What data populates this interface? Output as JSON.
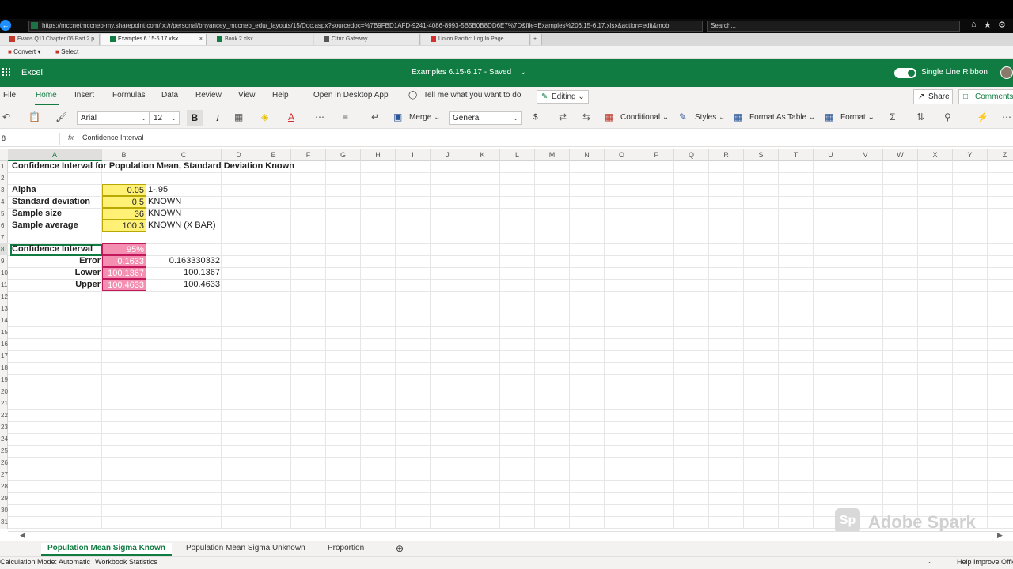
{
  "browser": {
    "url": "https://mccnetmccneb-my.sharepoint.com/:x:/r/personal/bhyancey_mccneb_edu/_layouts/15/Doc.aspx?sourcedoc=%7B9FBD1AFD-9241-4086-8993-5B5B0B8DD6E7%7D&file=Examples%206.15-6.17.xlsx&action=edit&mob",
    "search_placeholder": "Search...",
    "tabs": [
      {
        "label": "Evans Q11 Chapter 06 Part 2.p..."
      },
      {
        "label": "Examples 6.15-6.17.xlsx"
      },
      {
        "label": "Book 2.xlsx"
      },
      {
        "label": "Citrix Gateway"
      },
      {
        "label": "Union Pacific: Log In Page"
      }
    ],
    "favorites": {
      "convert": "Convert",
      "select": "Select"
    }
  },
  "app": {
    "name": "Excel",
    "doc_title": "Examples 6.15-6.17 - Saved",
    "single_line_ribbon": "Single Line Ribbon"
  },
  "ribbon": {
    "tabs": [
      "File",
      "Home",
      "Insert",
      "Formulas",
      "Data",
      "Review",
      "View",
      "Help",
      "Open in Desktop App"
    ],
    "tell_me": "Tell me what you want to do",
    "editing": "Editing",
    "share": "Share",
    "comments": "Comments"
  },
  "toolbar": {
    "font": "Arial",
    "size": "12",
    "bold": "B",
    "italic": "I",
    "merge": "Merge",
    "number_format": "General",
    "currency": "$",
    "conditional": "Conditional",
    "styles": "Styles",
    "format_as_table": "Format As Table",
    "format": "Format"
  },
  "formula_bar": {
    "name_box": "8",
    "fx": "fx",
    "content": "Confidence Interval"
  },
  "grid": {
    "columns": [
      "A",
      "B",
      "C",
      "D",
      "E",
      "F",
      "G",
      "H",
      "I",
      "J",
      "K",
      "L",
      "M",
      "N",
      "O",
      "P",
      "Q",
      "R",
      "S",
      "T",
      "U",
      "V",
      "W",
      "X",
      "Y",
      "Z"
    ],
    "rows": [
      "1",
      "2",
      "3",
      "4",
      "5",
      "6",
      "7",
      "8",
      "9",
      "10",
      "11",
      "12",
      "13",
      "14",
      "15",
      "16",
      "17",
      "18",
      "19",
      "20",
      "21",
      "22",
      "23",
      "24",
      "25",
      "26",
      "27",
      "28",
      "29",
      "30",
      "31"
    ],
    "title": "Confidence Interval for Population Mean, Standard Deviation Known",
    "inputs": [
      {
        "label": "Alpha",
        "value": "0.05",
        "note": "1-.95"
      },
      {
        "label": "Standard deviation",
        "value": "0.5",
        "note": "KNOWN"
      },
      {
        "label": "Sample size",
        "value": "36",
        "note": "KNOWN"
      },
      {
        "label": "Sample average",
        "value": "100.3",
        "note": "KNOWN (X BAR)"
      }
    ],
    "ci": {
      "label": "Confidence Interval",
      "level": "95%",
      "rows": [
        {
          "label": "Error",
          "value": "0.1633",
          "full": "0.163330332"
        },
        {
          "label": "Lower",
          "value": "100.1367",
          "full": "100.1367"
        },
        {
          "label": "Upper",
          "value": "100.4633",
          "full": "100.4633"
        }
      ]
    }
  },
  "sheets": [
    "Population Mean Sigma Known",
    "Population Mean Sigma Unknown",
    "Proportion"
  ],
  "status": {
    "calc_mode": "Calculation Mode: Automatic",
    "workbook_stats": "Workbook Statistics",
    "help_improve": "Help Improve Office"
  },
  "watermark": {
    "logo": "Sp",
    "text": "Adobe Spark"
  },
  "colors": {
    "excel_green": "#107c41",
    "input_yellow": "#fff176",
    "output_pink": "#f48fb1"
  }
}
